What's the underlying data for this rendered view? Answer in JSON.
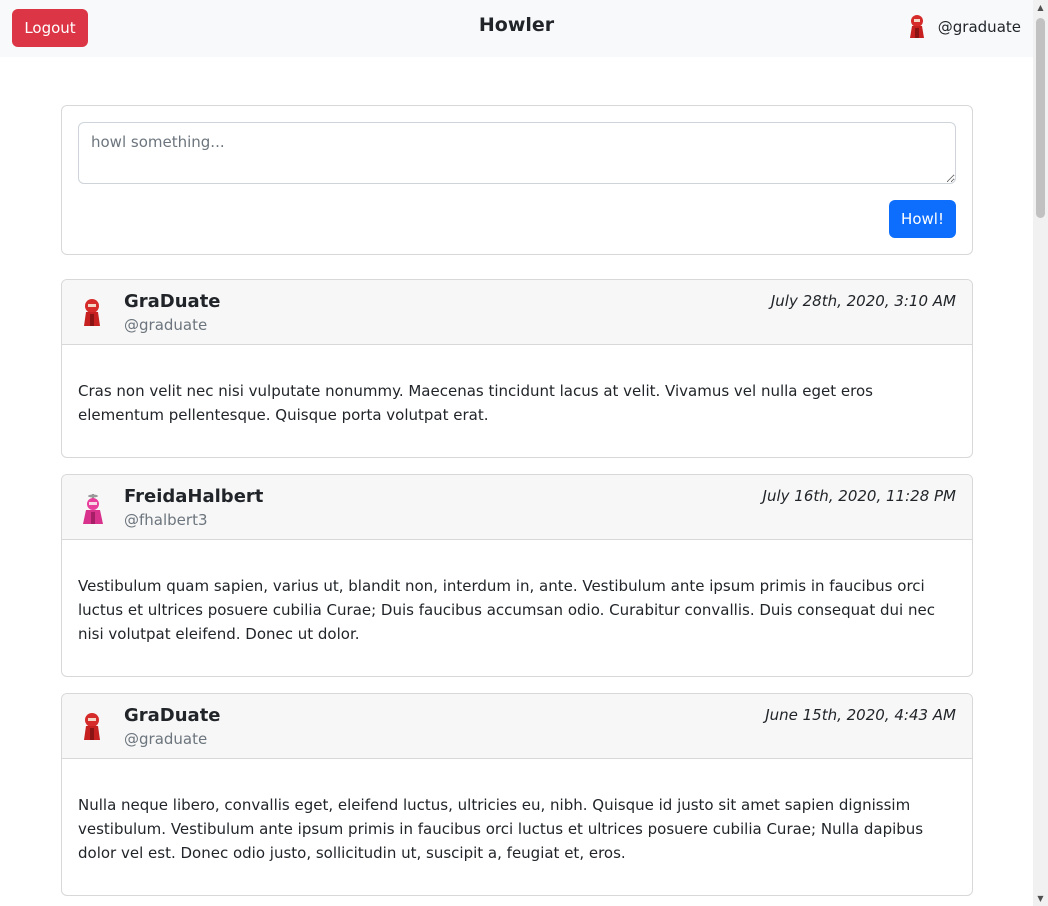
{
  "navbar": {
    "logout_label": "Logout",
    "brand": "Howler",
    "current_user": {
      "handle": "@graduate",
      "avatar_icon": "red-robot-avatar"
    }
  },
  "compose": {
    "placeholder": "howl something...",
    "value": "",
    "submit_label": "Howl!"
  },
  "feed": [
    {
      "display_name": "GraDuate",
      "username": "@graduate",
      "timestamp": "July 28th, 2020, 3:10 AM",
      "avatar_icon": "red-robot-avatar",
      "text": "Cras non velit nec nisi vulputate nonummy. Maecenas tincidunt lacus at velit. Vivamus vel nulla eget eros elementum pellentesque. Quisque porta volutpat erat."
    },
    {
      "display_name": "FreidaHalbert",
      "username": "@fhalbert3",
      "timestamp": "July 16th, 2020, 11:28 PM",
      "avatar_icon": "pink-robot-avatar",
      "text": "Vestibulum quam sapien, varius ut, blandit non, interdum in, ante. Vestibulum ante ipsum primis in faucibus orci luctus et ultrices posuere cubilia Curae; Duis faucibus accumsan odio. Curabitur convallis. Duis consequat dui nec nisi volutpat eleifend. Donec ut dolor."
    },
    {
      "display_name": "GraDuate",
      "username": "@graduate",
      "timestamp": "June 15th, 2020, 4:43 AM",
      "avatar_icon": "red-robot-avatar",
      "text": "Nulla neque libero, convallis eget, eleifend luctus, ultricies eu, nibh. Quisque id justo sit amet sapien dignissim vestibulum. Vestibulum ante ipsum primis in faucibus orci luctus et ultrices posuere cubilia Curae; Nulla dapibus dolor vel est. Donec odio justo, sollicitudin ut, suscipit a, feugiat et, eros."
    }
  ],
  "colors": {
    "logout": "#dc3545",
    "howl_button": "#0d6efd",
    "navbar_bg": "#f8f9fa",
    "card_header_bg": "#f7f7f7",
    "muted_text": "#6c757d",
    "red_avatar": "#d62b2b",
    "pink_avatar": "#e83e9c"
  }
}
